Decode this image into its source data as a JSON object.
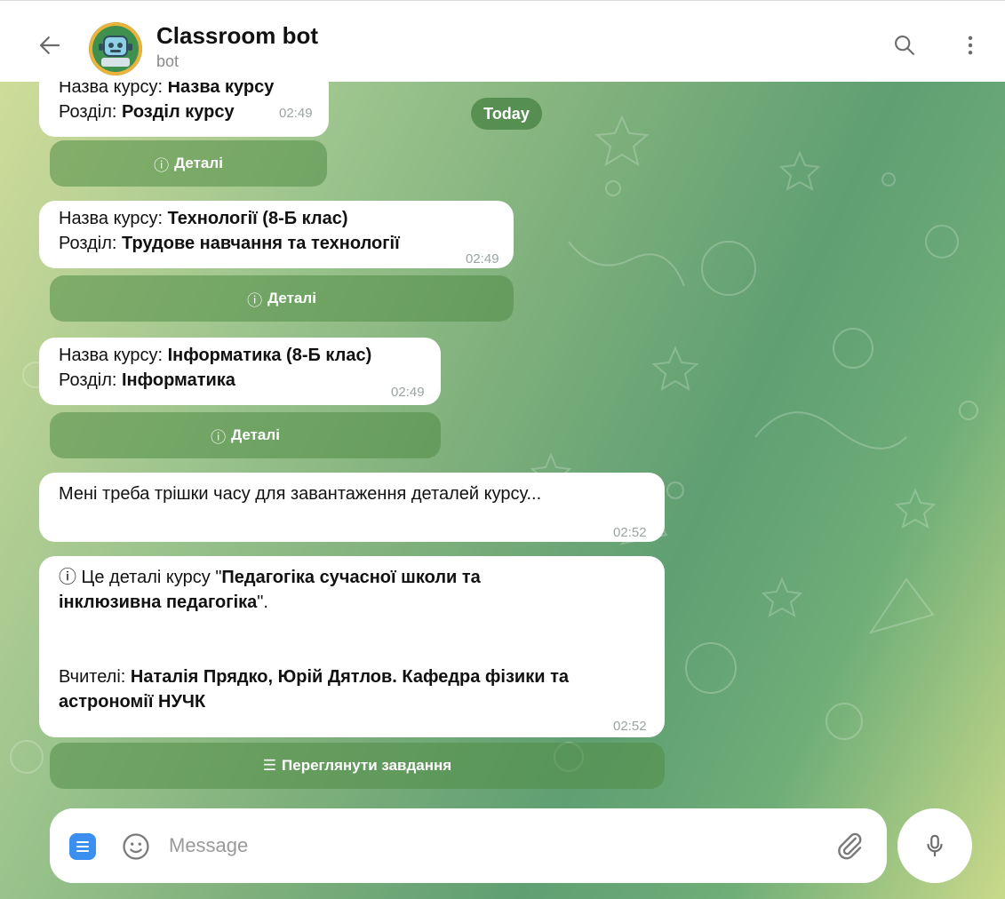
{
  "header": {
    "title": "Classroom bot",
    "status": "bot"
  },
  "chat": {
    "date_chip": "Today",
    "messages": [
      {
        "line1_label": "Назва курсу: ",
        "line1_value": "Назва курсу",
        "line2_label": "Розділ: ",
        "line2_value": "Розділ курсу",
        "time": "02:49",
        "button_icon": "ⓘ",
        "button_label": "Деталі"
      },
      {
        "line1_label": "Назва курсу: ",
        "line1_value": "Технології (8-Б клас)",
        "line2_label": "Розділ: ",
        "line2_value": "Трудове навчання та технології",
        "time": "02:49",
        "button_icon": "ⓘ",
        "button_label": "Деталі"
      },
      {
        "line1_label": "Назва курсу: ",
        "line1_value": "Інформатика (8-Б клас)",
        "line2_label": "Розділ: ",
        "line2_value": "Інформатика",
        "time": "02:49",
        "button_icon": "ⓘ",
        "button_label": "Деталі"
      },
      {
        "text": "Мені треба трішки часу для завантаження деталей курсу...",
        "time": "02:52"
      },
      {
        "intro_icon": "ⓘ",
        "intro_text": " Це деталі курсу \"",
        "course_name_line1": "Педагогіка сучасної школи та",
        "course_name_line2": "інклюзивна педагогіка",
        "intro_end": "\".",
        "teachers_label": "Вчителі: ",
        "teachers_line1": "Наталія Прядко, Юрій Дятлов. Кафедра фізики та",
        "teachers_line2": "астрономії НУЧК",
        "time": "02:52",
        "button_icon": "☰",
        "button_label": "Переглянути завдання"
      }
    ]
  },
  "input": {
    "placeholder": "Message",
    "value": ""
  },
  "icons": {
    "back": "arrow-left-icon",
    "search": "search-icon",
    "menu": "more-vertical-icon",
    "bot_menu": "bot-menu-icon",
    "emoji": "emoji-icon",
    "attach": "paperclip-icon",
    "mic": "microphone-icon"
  },
  "colors": {
    "accent_green": "#4f8f45",
    "menu_blue": "#3b8ff0"
  }
}
